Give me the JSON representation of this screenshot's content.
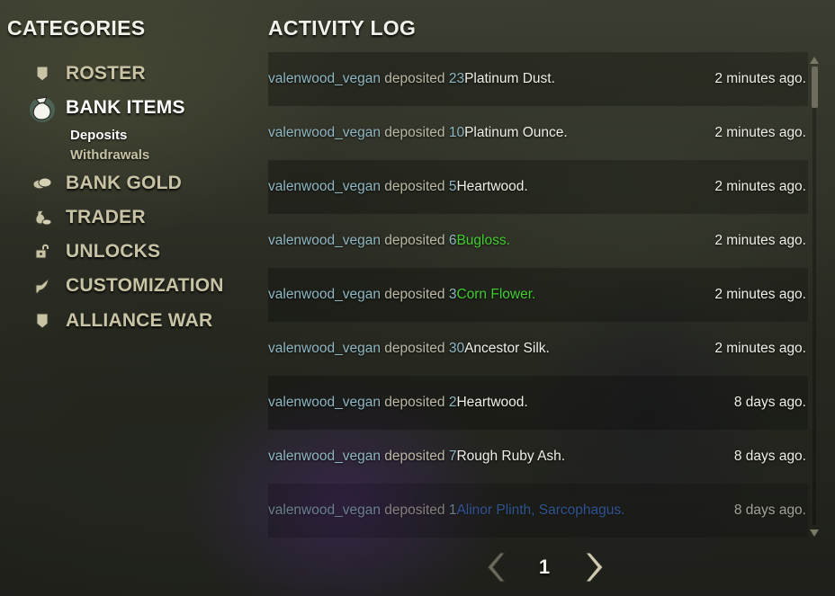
{
  "categories": {
    "title": "CATEGORIES",
    "items": [
      {
        "label": "ROSTER",
        "icon": "shield-banner-icon"
      },
      {
        "label": "BANK ITEMS",
        "icon": "bag-icon",
        "selected": true,
        "subitems": [
          {
            "label": "Deposits",
            "active": true
          },
          {
            "label": "Withdrawals",
            "active": false
          }
        ]
      },
      {
        "label": "BANK GOLD",
        "icon": "gold-coins-icon"
      },
      {
        "label": "TRADER",
        "icon": "money-bag-icon"
      },
      {
        "label": "UNLOCKS",
        "icon": "padlock-icon"
      },
      {
        "label": "CUSTOMIZATION",
        "icon": "quill-icon"
      },
      {
        "label": "ALLIANCE WAR",
        "icon": "shield-banner-icon"
      }
    ]
  },
  "activity_log": {
    "title": "ACTIVITY LOG",
    "entries": [
      {
        "user": "valenwood_vegan",
        "verb": "deposited",
        "qty": "23",
        "item": "Platinum Dust",
        "quality": "white",
        "time": "2 minutes ago."
      },
      {
        "user": "valenwood_vegan",
        "verb": "deposited",
        "qty": "10",
        "item": "Platinum Ounce",
        "quality": "white",
        "time": "2 minutes ago."
      },
      {
        "user": "valenwood_vegan",
        "verb": "deposited",
        "qty": "5",
        "item": "Heartwood",
        "quality": "white",
        "time": "2 minutes ago."
      },
      {
        "user": "valenwood_vegan",
        "verb": "deposited",
        "qty": "6",
        "item": "Bugloss",
        "quality": "green",
        "time": "2 minutes ago."
      },
      {
        "user": "valenwood_vegan",
        "verb": "deposited",
        "qty": "3",
        "item": "Corn Flower",
        "quality": "green",
        "time": "2 minutes ago."
      },
      {
        "user": "valenwood_vegan",
        "verb": "deposited",
        "qty": "30",
        "item": "Ancestor Silk",
        "quality": "white",
        "time": "2 minutes ago."
      },
      {
        "user": "valenwood_vegan",
        "verb": "deposited",
        "qty": "2",
        "item": "Heartwood",
        "quality": "white",
        "time": "8 days ago."
      },
      {
        "user": "valenwood_vegan",
        "verb": "deposited",
        "qty": "7",
        "item": "Rough Ruby Ash",
        "quality": "white",
        "time": "8 days ago."
      },
      {
        "user": "valenwood_vegan",
        "verb": "deposited",
        "qty": "1",
        "item": "Alinor Plinth, Sarcophagus",
        "quality": "blue",
        "time": "8 days ago."
      }
    ]
  },
  "pagination": {
    "page": "1"
  },
  "colors": {
    "user": "#8fb7c2",
    "item_white": "#f0efe8",
    "item_green": "#3fcf2a",
    "item_blue": "#3a72d8",
    "category_label": "#c8c3a4"
  }
}
